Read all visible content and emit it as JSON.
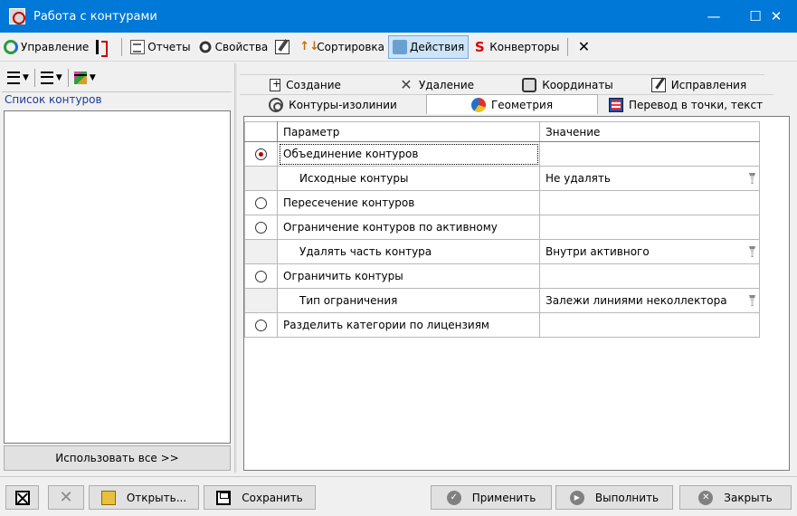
{
  "window": {
    "title": "Работа с контурами"
  },
  "window_buttons": {
    "minimize": "—",
    "maximize": "☐",
    "close": "✕"
  },
  "toolbar": {
    "items": [
      {
        "label": "Управление",
        "icon": "management-icon"
      },
      {
        "label": "",
        "icon": "bracket-icon"
      },
      {
        "label": "Отчеты",
        "icon": "report-icon"
      },
      {
        "label": "Свойства",
        "icon": "properties-icon"
      },
      {
        "label": "",
        "icon": "edit-icon"
      },
      {
        "label": "Сортировка",
        "icon": "sort-icon"
      },
      {
        "label": "Действия",
        "icon": "actions-icon",
        "pressed": true
      },
      {
        "label": "Конверторы",
        "icon": "converters-icon"
      },
      {
        "label": "",
        "icon": "tools-icon"
      }
    ]
  },
  "left_panel": {
    "list_label": "Список контуров",
    "use_all_button": "Использовать все >>"
  },
  "tabs": {
    "row1": [
      "Создание",
      "Удаление",
      "Координаты",
      "Исправления"
    ],
    "row2": [
      "Контуры-изолинии",
      "Геометрия",
      "Перевод в точки, текст"
    ],
    "active": "Геометрия"
  },
  "grid": {
    "headers": {
      "param": "Параметр",
      "value": "Значение"
    },
    "rows": [
      {
        "kind": "radio",
        "checked": true,
        "param": "Объединение контуров",
        "value": ""
      },
      {
        "kind": "child",
        "param": "Исходные контуры",
        "value": "Не удалять",
        "dropdown": true
      },
      {
        "kind": "radio",
        "checked": false,
        "param": "Пересечение контуров",
        "value": ""
      },
      {
        "kind": "radio",
        "checked": false,
        "param": "Ограничение контуров по активному",
        "value": ""
      },
      {
        "kind": "child",
        "param": "Удалять часть контура",
        "value": "Внутри активного",
        "dropdown": true
      },
      {
        "kind": "radio",
        "checked": false,
        "param": "Ограничить контуры",
        "value": ""
      },
      {
        "kind": "child",
        "param": "Тип ограничения",
        "value": "Залежи линиями неколлектора",
        "dropdown": true
      },
      {
        "kind": "radio",
        "checked": false,
        "param": "Разделить категории по лицензиям",
        "value": ""
      }
    ]
  },
  "buttons": {
    "open": "Открыть...",
    "save": "Сохранить",
    "apply": "Применить",
    "run": "Выполнить",
    "close": "Закрыть"
  },
  "colors": {
    "titlebar": "#0078d7",
    "radio_checked": "#c00000",
    "list_label": "#1e3a9a"
  }
}
